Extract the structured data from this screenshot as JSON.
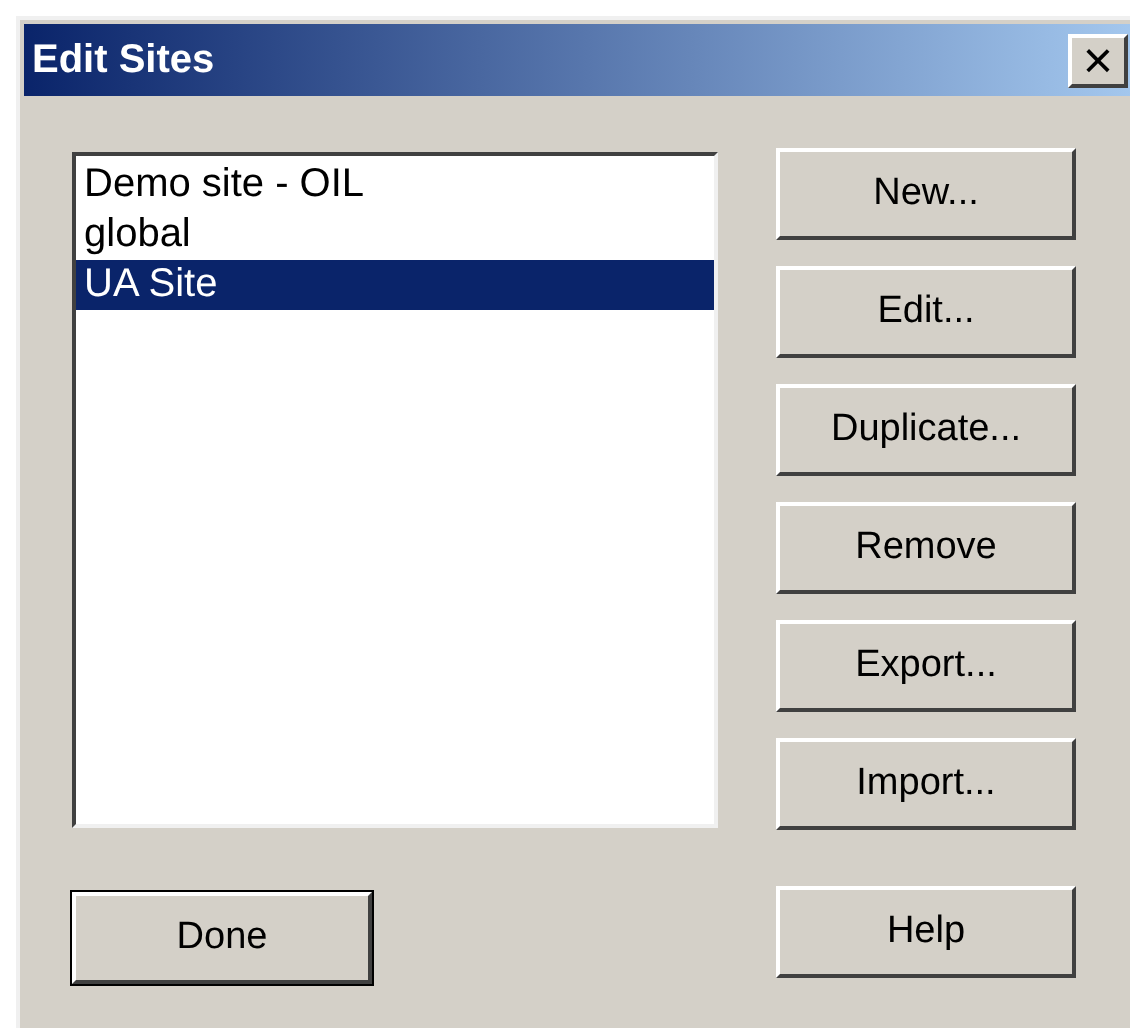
{
  "window": {
    "title": "Edit Sites",
    "close_glyph": "×"
  },
  "sites": [
    {
      "label": "Demo site - OIL",
      "selected": false
    },
    {
      "label": "global",
      "selected": false
    },
    {
      "label": "UA Site",
      "selected": true
    }
  ],
  "side_buttons": [
    {
      "label": "New..."
    },
    {
      "label": "Edit..."
    },
    {
      "label": "Duplicate..."
    },
    {
      "label": "Remove"
    },
    {
      "label": "Export..."
    },
    {
      "label": "Import..."
    }
  ],
  "done_button": {
    "label": "Done",
    "default": true
  },
  "help_button": {
    "label": "Help"
  }
}
